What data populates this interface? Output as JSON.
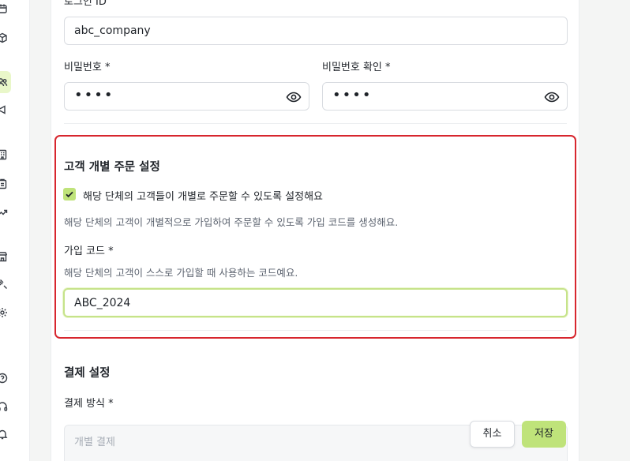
{
  "sidebar": {
    "icons": [
      "calendar-icon",
      "package-icon",
      "users-icon",
      "megaphone-icon",
      "building-icon",
      "clipboard-icon",
      "trending-icon",
      "store-icon",
      "tools-icon",
      "gear-icon",
      "help-icon",
      "headset-icon",
      "bell-icon"
    ]
  },
  "account": {
    "login_id_label": "로그인 ID",
    "login_id_value": "abc_company",
    "password_label": "비밀번호 *",
    "password_value": "••••",
    "password_confirm_label": "비밀번호 확인 *",
    "password_confirm_value": "••••"
  },
  "individual_order": {
    "title": "고객 개별 주문 설정",
    "checkbox_label": "해당 단체의 고객들이 개별로 주문할 수 있도록 설정해요",
    "checkbox_checked": true,
    "description": "해당 단체의 고객이 개별적으로 가입하여 주문할 수 있도록 가입 코드를 생성해요.",
    "signup_code_label": "가입 코드 *",
    "signup_code_help": "해당 단체의 고객이 스스로 가입할 때 사용하는 코드예요.",
    "signup_code_value": "ABC_2024"
  },
  "payment": {
    "title": "결제 설정",
    "method_label": "결제 방식 *",
    "method_value": "개별 결제"
  },
  "actions": {
    "cancel_label": "취소",
    "save_label": "저장"
  },
  "colors": {
    "accent": "#bfe37a",
    "highlight_border": "#d7262e"
  }
}
